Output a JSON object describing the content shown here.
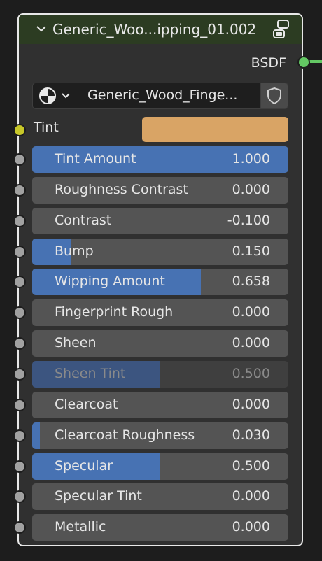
{
  "node": {
    "title": "Generic_Woo...ipping_01.002",
    "output_label": "BSDF",
    "output_socket_color": "#63c763",
    "material_name": "Generic_Wood_Finge...",
    "tint_label": "Tint",
    "tint_color": "#d9a465",
    "tint_socket_color": "#c7c729",
    "value_socket_color": "#a1a1a1",
    "accent_color": "#4772b3"
  },
  "sliders": [
    {
      "label": "Tint Amount",
      "value": "1.000",
      "fill": 1.0,
      "enabled": true
    },
    {
      "label": "Roughness Contrast",
      "value": "0.000",
      "fill": 0.0,
      "enabled": true
    },
    {
      "label": "Contrast",
      "value": "-0.100",
      "fill": 0.0,
      "enabled": true
    },
    {
      "label": "Bump",
      "value": "0.150",
      "fill": 0.15,
      "enabled": true
    },
    {
      "label": "Wipping Amount",
      "value": "0.658",
      "fill": 0.658,
      "enabled": true
    },
    {
      "label": "Fingerprint Rough",
      "value": "0.000",
      "fill": 0.0,
      "enabled": true
    },
    {
      "label": "Sheen",
      "value": "0.000",
      "fill": 0.0,
      "enabled": true
    },
    {
      "label": "Sheen Tint",
      "value": "0.500",
      "fill": 0.5,
      "enabled": false
    },
    {
      "label": "Clearcoat",
      "value": "0.000",
      "fill": 0.0,
      "enabled": true
    },
    {
      "label": "Clearcoat Roughness",
      "value": "0.030",
      "fill": 0.03,
      "enabled": true
    },
    {
      "label": "Specular",
      "value": "0.500",
      "fill": 0.5,
      "enabled": true
    },
    {
      "label": "Specular Tint",
      "value": "0.000",
      "fill": 0.0,
      "enabled": true
    },
    {
      "label": "Metallic",
      "value": "0.000",
      "fill": 0.0,
      "enabled": true
    }
  ],
  "icons": {
    "collapse": "chevron-down-icon",
    "node_type": "node-group-icon",
    "material": "material-sphere-icon",
    "browse": "chevron-down-icon",
    "fake_user": "shield-icon"
  }
}
